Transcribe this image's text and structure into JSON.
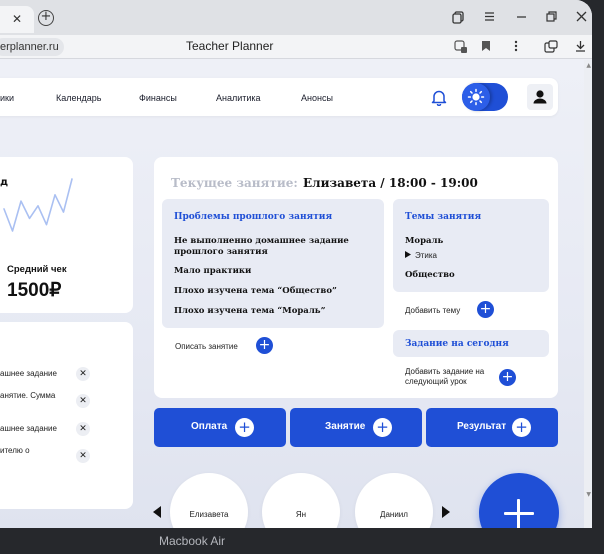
{
  "browser": {
    "url_fragment": "erplanner.ru",
    "page_title": "Teacher Planner",
    "tab_close_glyph": "✕",
    "new_tab_glyph": "+"
  },
  "nav": {
    "items": [
      "ики",
      "Календарь",
      "Финансы",
      "Аналитика",
      "Анонсы"
    ]
  },
  "stats": {
    "title_fragment": "д",
    "avg_check_label": "Средний чек",
    "avg_check_value": "1500₽",
    "trend": [
      36,
      22,
      41,
      30,
      38,
      26,
      45,
      34,
      55
    ]
  },
  "tasks": [
    {
      "text": "ашнее задание"
    },
    {
      "text": "анятие. Сумма"
    },
    {
      "text": "ашнее задание"
    },
    {
      "text": "ителю о"
    }
  ],
  "lesson": {
    "current_label": "Текущее занятие:",
    "current_value": "Елизавета / 18:00 - 19:00",
    "problems_title": "Проблемы прошлого занятия",
    "problems": [
      "Не выполненно домашнее задание прошлого занятия",
      "Мало практики",
      "Плохо изучена тема “Общество”",
      "Плохо изучена тема “Мораль”"
    ],
    "describe_label": "Описать занятие",
    "topics_title": "Темы занятия",
    "topics": [
      {
        "name": "Мораль",
        "sub": "Этика"
      },
      {
        "name": "Общество",
        "sub": ""
      }
    ],
    "add_topic_label": "Добавить тему",
    "today_title": "Задание на сегодня",
    "add_task_label": "Добавить задание на следующий урок"
  },
  "actions": [
    {
      "label": "Оплата"
    },
    {
      "label": "Занятие"
    },
    {
      "label": "Результат"
    }
  ],
  "students": [
    "Елизавета",
    "Ян",
    "Даниил"
  ],
  "bezel_label": "Macbook Air",
  "colors": {
    "accent": "#1f4fd6",
    "panel": "#e8ebf4",
    "muted_heading": "#b8bcc8"
  }
}
